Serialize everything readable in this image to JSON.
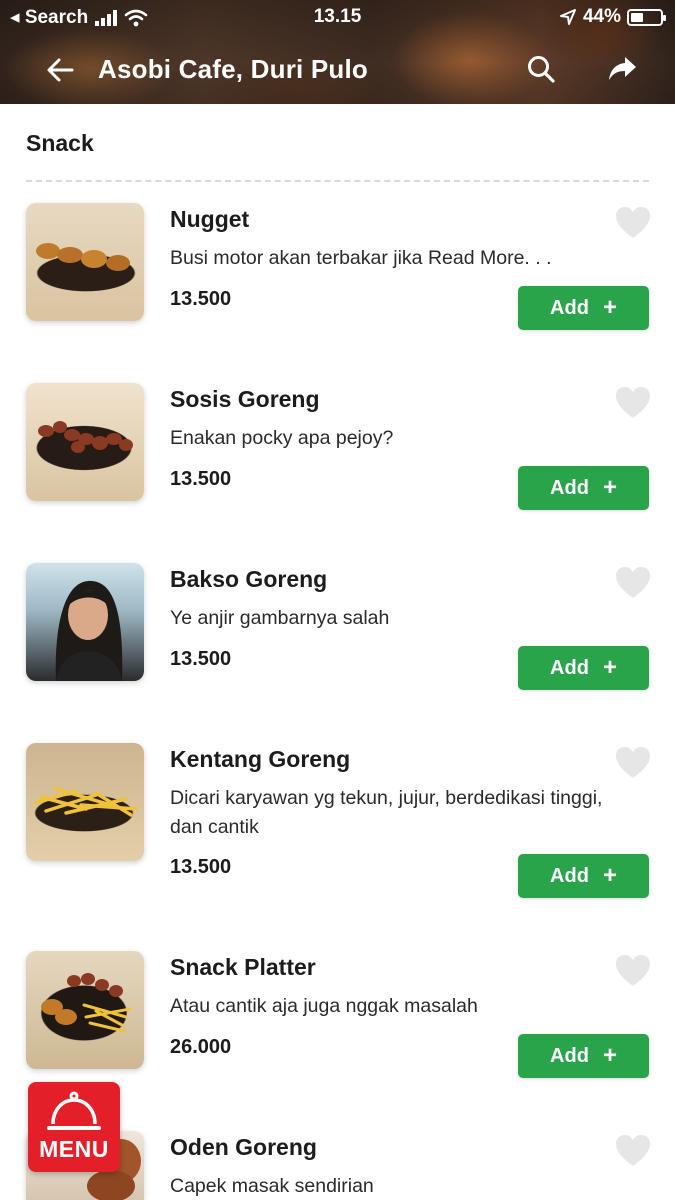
{
  "status_bar": {
    "carrier": "◂ Search",
    "time": "13.15",
    "battery": "44%",
    "battery_level": 0.44
  },
  "header": {
    "title": "Asobi Cafe, Duri Pulo"
  },
  "section": {
    "title": "Snack"
  },
  "add_button": {
    "label": "Add",
    "plus": "+"
  },
  "menu_button": {
    "label": "MENU"
  },
  "items": [
    {
      "name": "Nugget",
      "desc_lines": [
        "Busi motor akan terbakar jika Read More. . ."
      ],
      "price": "13.500",
      "thumbnail": "nugget-photo"
    },
    {
      "name": "Sosis Goreng",
      "desc_lines": [
        "Enakan pocky apa pejoy?"
      ],
      "price": "13.500",
      "thumbnail": "sausage-photo"
    },
    {
      "name": "Bakso Goreng",
      "desc_lines": [
        "Ye anjir gambarnya salah"
      ],
      "price": "13.500",
      "thumbnail": "person-photo"
    },
    {
      "name": "Kentang Goreng",
      "desc_lines": [
        "Dicari karyawan yg tekun, jujur, berdedikasi tinggi,",
        "dan cantik"
      ],
      "price": "13.500",
      "thumbnail": "fries-photo"
    },
    {
      "name": "Snack Platter",
      "desc_lines": [
        "Atau cantik aja juga nggak masalah"
      ],
      "price": "26.000",
      "thumbnail": "platter-photo"
    },
    {
      "name": "Oden Goreng",
      "desc_lines": [
        "Capek masak sendirian"
      ],
      "price": "",
      "thumbnail": "oden-photo"
    }
  ],
  "colors": {
    "accent_green": "#2aa44a",
    "menu_red": "#e3202a",
    "heart_gray": "#e6e6e6"
  }
}
